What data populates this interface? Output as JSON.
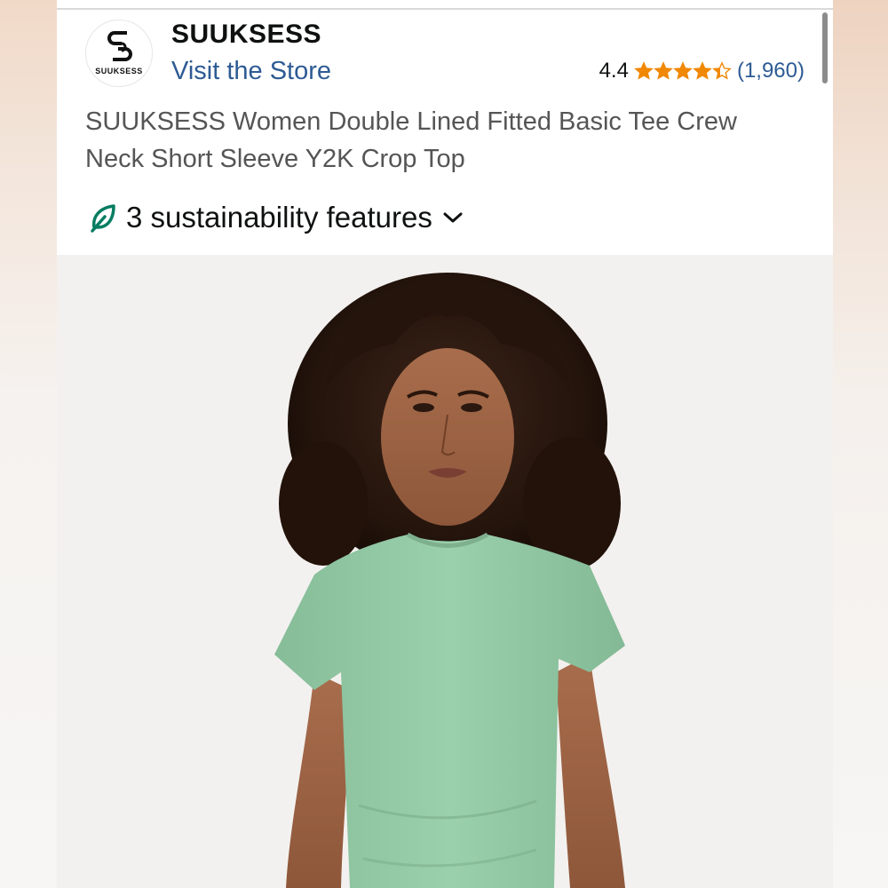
{
  "store": {
    "brand": "SUUKSESS",
    "logo_text": "SUUKSESS",
    "visit_label": "Visit the Store"
  },
  "rating": {
    "value": "4.4",
    "stars": 4.4,
    "count": "(1,960)",
    "star_color": "#f08804"
  },
  "product": {
    "title": "SUUKSESS Women Double Lined Fitted Basic Tee Crew Neck Short Sleeve Y2K Crop Top"
  },
  "sustainability": {
    "label": "3 sustainability features",
    "leaf_color": "#067d62"
  },
  "image": {
    "shirt_color": "#93c9a6"
  }
}
